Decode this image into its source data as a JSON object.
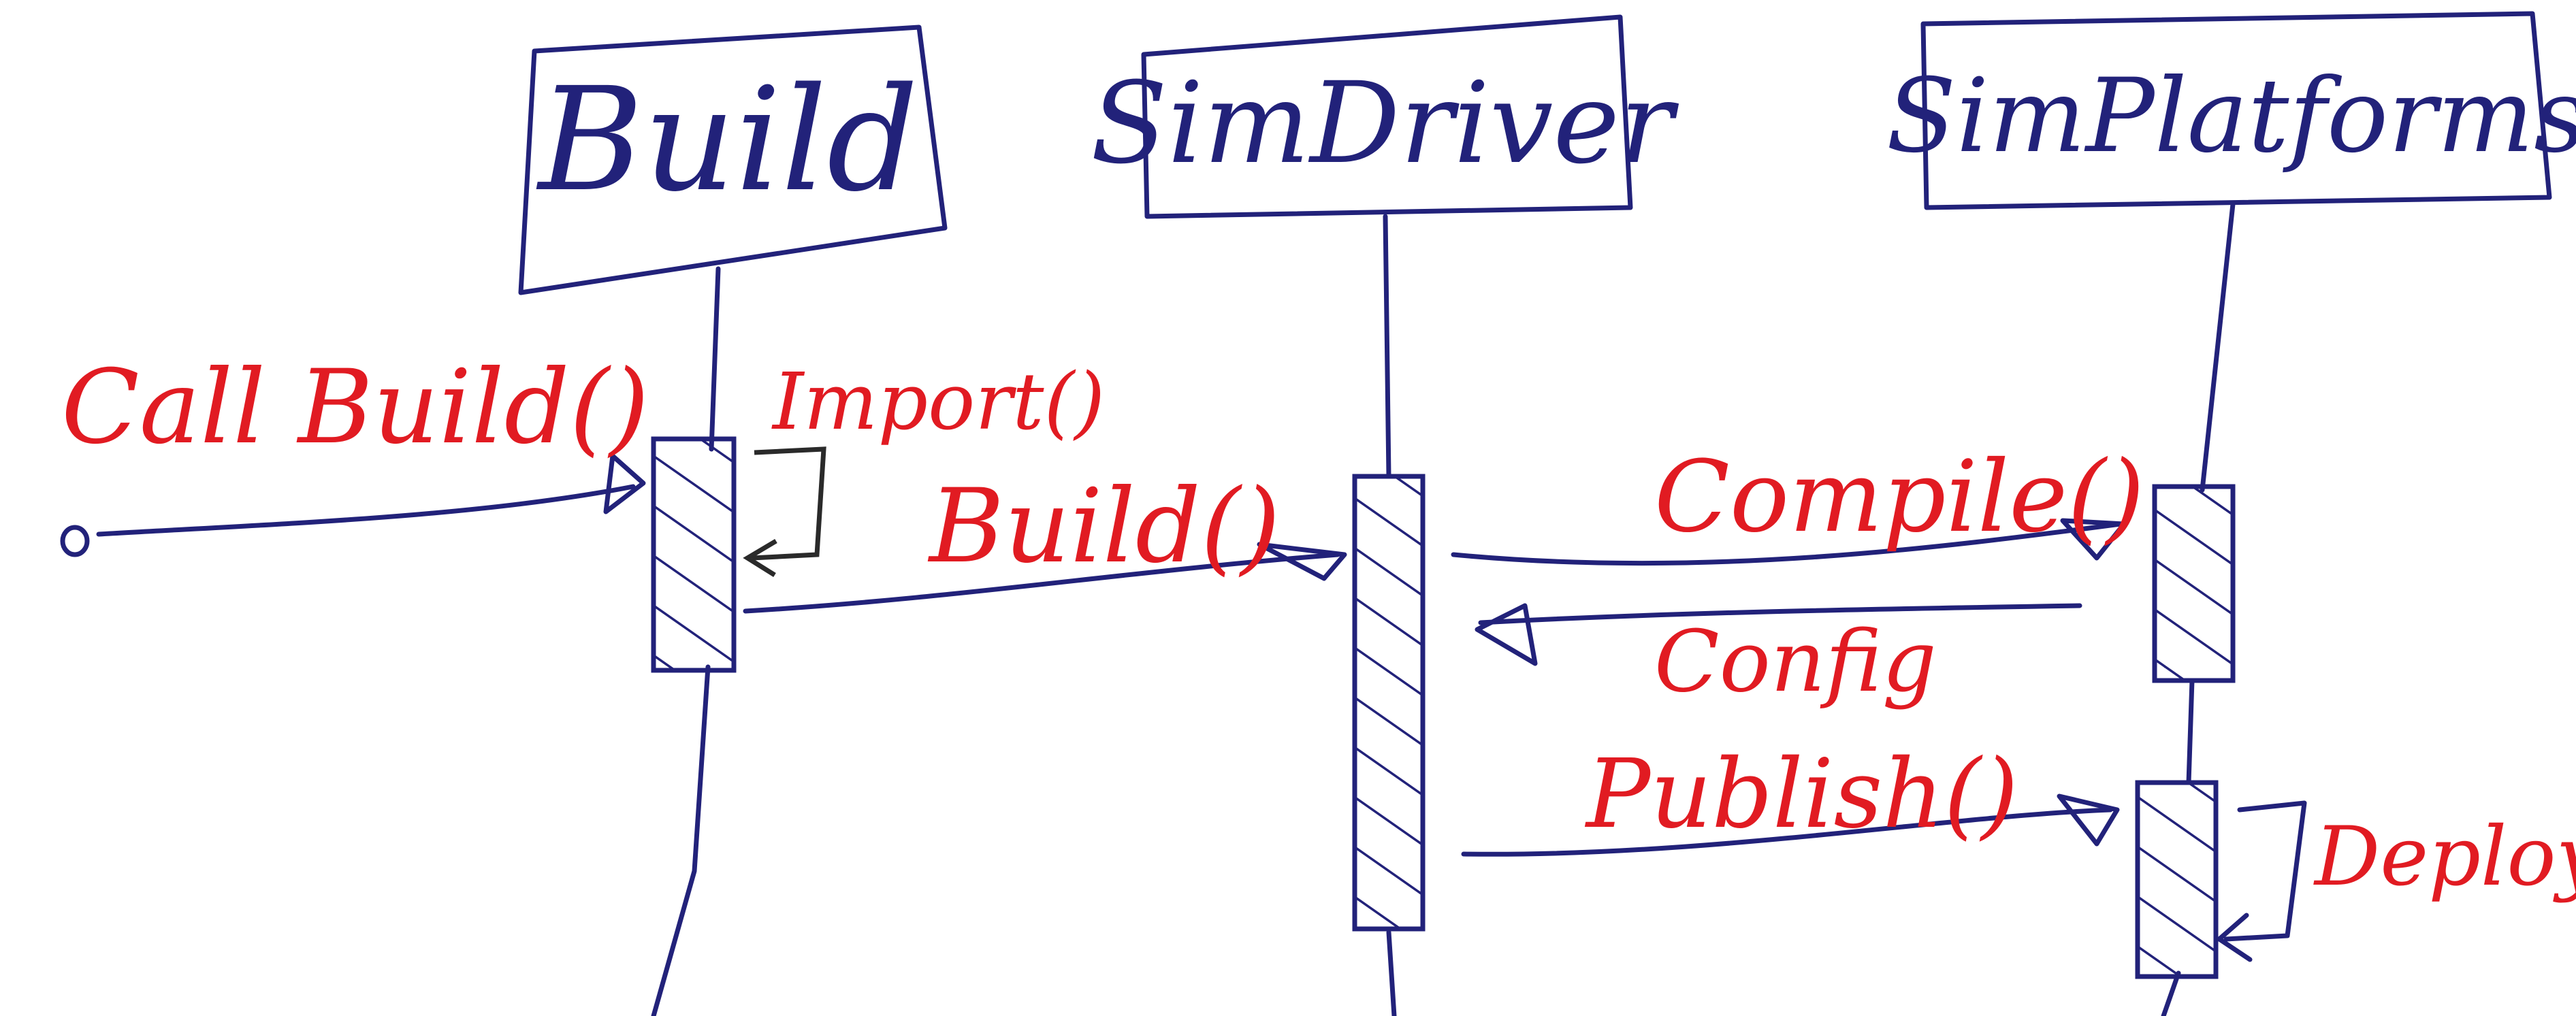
{
  "diagram": {
    "participants": [
      {
        "id": "build",
        "label": "Build"
      },
      {
        "id": "simdriver",
        "label": "SimDriver"
      },
      {
        "id": "simplatforms",
        "label": "SimPlatforms"
      }
    ],
    "messages": [
      {
        "from": "start",
        "to": "build",
        "label": "Call Build()"
      },
      {
        "from": "build",
        "to": "build",
        "label": "Import()"
      },
      {
        "from": "build",
        "to": "simdriver",
        "label": "Build()"
      },
      {
        "from": "simdriver",
        "to": "simplatforms",
        "label": "Compile()"
      },
      {
        "from": "simplatforms",
        "to": "simdriver",
        "label": "Config"
      },
      {
        "from": "simdriver",
        "to": "simplatforms",
        "label": "Publish()"
      },
      {
        "from": "simplatforms",
        "to": "simplatforms",
        "label": "Deploy()"
      }
    ],
    "colors": {
      "ink_blue": "#22227a",
      "ink_red": "#e11b22"
    }
  }
}
